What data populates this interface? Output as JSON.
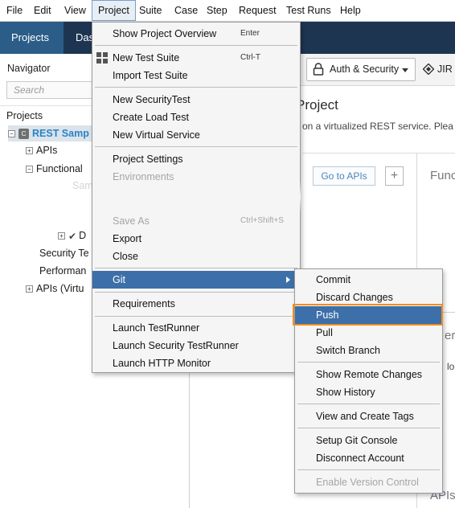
{
  "menubar": {
    "items": [
      {
        "label": "File"
      },
      {
        "label": "Edit"
      },
      {
        "label": "View"
      },
      {
        "label": "Project"
      },
      {
        "label": "Suite"
      },
      {
        "label": "Case"
      },
      {
        "label": "Step"
      },
      {
        "label": "Request"
      },
      {
        "label": "Test Runs"
      },
      {
        "label": "Help"
      }
    ]
  },
  "tabs": [
    {
      "label": "Projects"
    },
    {
      "label": "Das"
    }
  ],
  "navigator": {
    "title": "Navigator",
    "search_placeholder": "Search",
    "projects_label": "Projects",
    "tree": {
      "root": "REST Samp",
      "root_icon_letter": "C",
      "apis": "APIs",
      "functional": "Functional",
      "faded": "Sam",
      "d_item": "D",
      "security": "Security Te",
      "performance": "Performan",
      "apis_virtual": "APIs (Virtu"
    }
  },
  "toolbar": {
    "auth_label": "Auth & Security",
    "jira_label": "JIR"
  },
  "main": {
    "title": "Project",
    "description": "on a virtualized REST service. Plea",
    "goto_label": "Go to APIs",
    "plus_label": "+",
    "frag_func": "Func",
    "frag_erf": "erf",
    "frag_lo": "lo",
    "frag_apis": "APIs"
  },
  "project_menu": {
    "show_overview": "Show Project Overview",
    "show_overview_sc": "Enter",
    "new_test_suite": "New Test Suite",
    "new_test_suite_sc": "Ctrl-T",
    "import_test_suite": "Import Test Suite",
    "new_security_test": "New SecurityTest",
    "create_load_test": "Create Load Test",
    "new_virtual_service": "New Virtual Service",
    "project_settings": "Project Settings",
    "environments": "Environments",
    "save_as": "Save As",
    "save_as_sc": "Ctrl+Shift+S",
    "export": "Export",
    "close": "Close",
    "git": "Git",
    "requirements": "Requirements",
    "launch_testrunner": "Launch TestRunner",
    "launch_security_testrunner": "Launch Security TestRunner",
    "launch_http_monitor": "Launch HTTP Monitor"
  },
  "git_menu": {
    "commit": "Commit",
    "discard_changes": "Discard Changes",
    "push": "Push",
    "pull": "Pull",
    "switch_branch": "Switch Branch",
    "show_remote_changes": "Show Remote Changes",
    "show_history": "Show History",
    "view_create_tags": "View and Create Tags",
    "setup_git_console": "Setup Git Console",
    "disconnect_account": "Disconnect Account",
    "enable_version_control": "Enable Version Control"
  },
  "colors": {
    "tabbar_bg": "#1e3551",
    "tab_active": "#2b5d88",
    "menu_highlight": "#3d6fa8",
    "push_outline": "#f28c1f",
    "link_blue": "#2a83c4"
  }
}
